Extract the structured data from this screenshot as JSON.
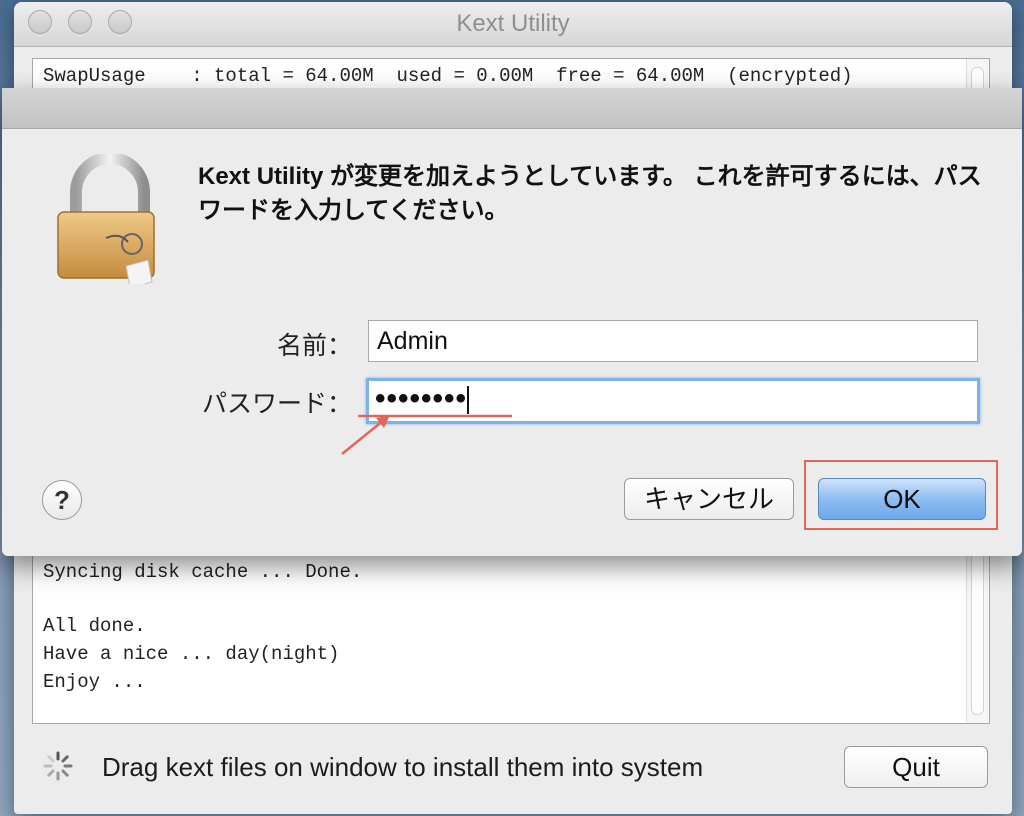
{
  "window": {
    "title": "Kext Utility"
  },
  "console": {
    "top_line": "SwapUsage    : total = 64.00M  used = 0.00M  free = 64.00M  (encrypted)",
    "lines": [
      "Syncing disk cache ... Done.",
      "",
      "All done.",
      "Have a nice ... day(night)",
      "Enjoy ..."
    ]
  },
  "statusbar": {
    "text": "Drag kext files on window to install them into system",
    "quit_label": "Quit"
  },
  "auth_dialog": {
    "message": "Kext Utility が変更を加えようとしています。 これを許可するには、パスワードを入力してください。",
    "name_label": "名前：",
    "name_value": "Admin",
    "password_label": "パスワード：",
    "password_value": "••••••••",
    "help_label": "?",
    "cancel_label": "キャンセル",
    "ok_label": "OK"
  },
  "annotation": {
    "color": "#e0665a"
  }
}
